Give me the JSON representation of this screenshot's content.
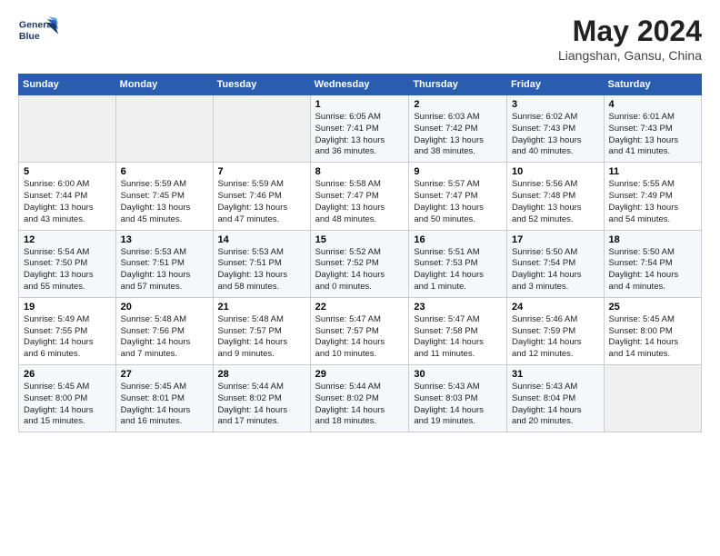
{
  "header": {
    "logo_line1": "General",
    "logo_line2": "Blue",
    "title": "May 2024",
    "subtitle": "Liangshan, Gansu, China"
  },
  "weekdays": [
    "Sunday",
    "Monday",
    "Tuesday",
    "Wednesday",
    "Thursday",
    "Friday",
    "Saturday"
  ],
  "weeks": [
    [
      {
        "day": "",
        "sunrise": "",
        "sunset": "",
        "daylight": ""
      },
      {
        "day": "",
        "sunrise": "",
        "sunset": "",
        "daylight": ""
      },
      {
        "day": "",
        "sunrise": "",
        "sunset": "",
        "daylight": ""
      },
      {
        "day": "1",
        "sunrise": "Sunrise: 6:05 AM",
        "sunset": "Sunset: 7:41 PM",
        "daylight": "Daylight: 13 hours and 36 minutes."
      },
      {
        "day": "2",
        "sunrise": "Sunrise: 6:03 AM",
        "sunset": "Sunset: 7:42 PM",
        "daylight": "Daylight: 13 hours and 38 minutes."
      },
      {
        "day": "3",
        "sunrise": "Sunrise: 6:02 AM",
        "sunset": "Sunset: 7:43 PM",
        "daylight": "Daylight: 13 hours and 40 minutes."
      },
      {
        "day": "4",
        "sunrise": "Sunrise: 6:01 AM",
        "sunset": "Sunset: 7:43 PM",
        "daylight": "Daylight: 13 hours and 41 minutes."
      }
    ],
    [
      {
        "day": "5",
        "sunrise": "Sunrise: 6:00 AM",
        "sunset": "Sunset: 7:44 PM",
        "daylight": "Daylight: 13 hours and 43 minutes."
      },
      {
        "day": "6",
        "sunrise": "Sunrise: 5:59 AM",
        "sunset": "Sunset: 7:45 PM",
        "daylight": "Daylight: 13 hours and 45 minutes."
      },
      {
        "day": "7",
        "sunrise": "Sunrise: 5:59 AM",
        "sunset": "Sunset: 7:46 PM",
        "daylight": "Daylight: 13 hours and 47 minutes."
      },
      {
        "day": "8",
        "sunrise": "Sunrise: 5:58 AM",
        "sunset": "Sunset: 7:47 PM",
        "daylight": "Daylight: 13 hours and 48 minutes."
      },
      {
        "day": "9",
        "sunrise": "Sunrise: 5:57 AM",
        "sunset": "Sunset: 7:47 PM",
        "daylight": "Daylight: 13 hours and 50 minutes."
      },
      {
        "day": "10",
        "sunrise": "Sunrise: 5:56 AM",
        "sunset": "Sunset: 7:48 PM",
        "daylight": "Daylight: 13 hours and 52 minutes."
      },
      {
        "day": "11",
        "sunrise": "Sunrise: 5:55 AM",
        "sunset": "Sunset: 7:49 PM",
        "daylight": "Daylight: 13 hours and 54 minutes."
      }
    ],
    [
      {
        "day": "12",
        "sunrise": "Sunrise: 5:54 AM",
        "sunset": "Sunset: 7:50 PM",
        "daylight": "Daylight: 13 hours and 55 minutes."
      },
      {
        "day": "13",
        "sunrise": "Sunrise: 5:53 AM",
        "sunset": "Sunset: 7:51 PM",
        "daylight": "Daylight: 13 hours and 57 minutes."
      },
      {
        "day": "14",
        "sunrise": "Sunrise: 5:53 AM",
        "sunset": "Sunset: 7:51 PM",
        "daylight": "Daylight: 13 hours and 58 minutes."
      },
      {
        "day": "15",
        "sunrise": "Sunrise: 5:52 AM",
        "sunset": "Sunset: 7:52 PM",
        "daylight": "Daylight: 14 hours and 0 minutes."
      },
      {
        "day": "16",
        "sunrise": "Sunrise: 5:51 AM",
        "sunset": "Sunset: 7:53 PM",
        "daylight": "Daylight: 14 hours and 1 minute."
      },
      {
        "day": "17",
        "sunrise": "Sunrise: 5:50 AM",
        "sunset": "Sunset: 7:54 PM",
        "daylight": "Daylight: 14 hours and 3 minutes."
      },
      {
        "day": "18",
        "sunrise": "Sunrise: 5:50 AM",
        "sunset": "Sunset: 7:54 PM",
        "daylight": "Daylight: 14 hours and 4 minutes."
      }
    ],
    [
      {
        "day": "19",
        "sunrise": "Sunrise: 5:49 AM",
        "sunset": "Sunset: 7:55 PM",
        "daylight": "Daylight: 14 hours and 6 minutes."
      },
      {
        "day": "20",
        "sunrise": "Sunrise: 5:48 AM",
        "sunset": "Sunset: 7:56 PM",
        "daylight": "Daylight: 14 hours and 7 minutes."
      },
      {
        "day": "21",
        "sunrise": "Sunrise: 5:48 AM",
        "sunset": "Sunset: 7:57 PM",
        "daylight": "Daylight: 14 hours and 9 minutes."
      },
      {
        "day": "22",
        "sunrise": "Sunrise: 5:47 AM",
        "sunset": "Sunset: 7:57 PM",
        "daylight": "Daylight: 14 hours and 10 minutes."
      },
      {
        "day": "23",
        "sunrise": "Sunrise: 5:47 AM",
        "sunset": "Sunset: 7:58 PM",
        "daylight": "Daylight: 14 hours and 11 minutes."
      },
      {
        "day": "24",
        "sunrise": "Sunrise: 5:46 AM",
        "sunset": "Sunset: 7:59 PM",
        "daylight": "Daylight: 14 hours and 12 minutes."
      },
      {
        "day": "25",
        "sunrise": "Sunrise: 5:45 AM",
        "sunset": "Sunset: 8:00 PM",
        "daylight": "Daylight: 14 hours and 14 minutes."
      }
    ],
    [
      {
        "day": "26",
        "sunrise": "Sunrise: 5:45 AM",
        "sunset": "Sunset: 8:00 PM",
        "daylight": "Daylight: 14 hours and 15 minutes."
      },
      {
        "day": "27",
        "sunrise": "Sunrise: 5:45 AM",
        "sunset": "Sunset: 8:01 PM",
        "daylight": "Daylight: 14 hours and 16 minutes."
      },
      {
        "day": "28",
        "sunrise": "Sunrise: 5:44 AM",
        "sunset": "Sunset: 8:02 PM",
        "daylight": "Daylight: 14 hours and 17 minutes."
      },
      {
        "day": "29",
        "sunrise": "Sunrise: 5:44 AM",
        "sunset": "Sunset: 8:02 PM",
        "daylight": "Daylight: 14 hours and 18 minutes."
      },
      {
        "day": "30",
        "sunrise": "Sunrise: 5:43 AM",
        "sunset": "Sunset: 8:03 PM",
        "daylight": "Daylight: 14 hours and 19 minutes."
      },
      {
        "day": "31",
        "sunrise": "Sunrise: 5:43 AM",
        "sunset": "Sunset: 8:04 PM",
        "daylight": "Daylight: 14 hours and 20 minutes."
      },
      {
        "day": "",
        "sunrise": "",
        "sunset": "",
        "daylight": ""
      }
    ]
  ]
}
